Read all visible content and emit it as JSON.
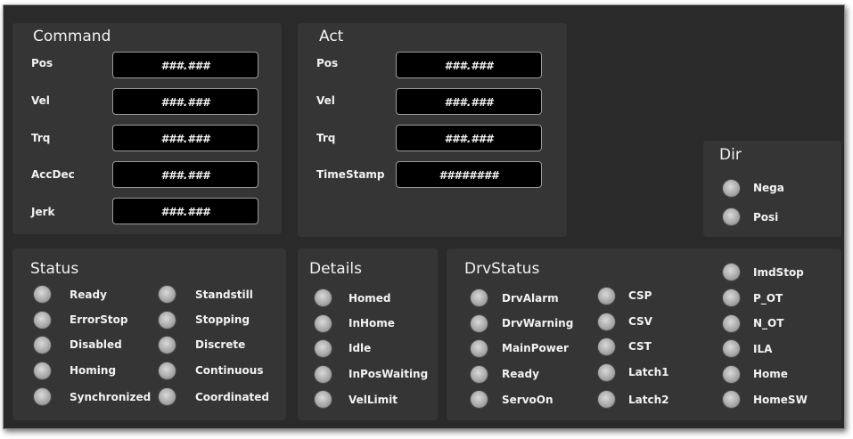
{
  "command": {
    "title": "Command",
    "fields": [
      {
        "label": "Pos",
        "value": "###.###"
      },
      {
        "label": "Vel",
        "value": "###.###"
      },
      {
        "label": "Trq",
        "value": "###.###"
      },
      {
        "label": "AccDec",
        "value": "###.###"
      },
      {
        "label": "Jerk",
        "value": "###.###"
      }
    ]
  },
  "act": {
    "title": "Act",
    "fields": [
      {
        "label": "Pos",
        "value": "###.###"
      },
      {
        "label": "Vel",
        "value": "###.###"
      },
      {
        "label": "Trq",
        "value": "###.###"
      },
      {
        "label": "TimeStamp",
        "value": "########"
      }
    ]
  },
  "dir": {
    "title": "Dir",
    "items": [
      "Nega",
      "Posi"
    ]
  },
  "status": {
    "title": "Status",
    "col1": [
      "Ready",
      "ErrorStop",
      "Disabled",
      "Homing",
      "Synchronized"
    ],
    "col2": [
      "Standstill",
      "Stopping",
      "Discrete",
      "Continuous",
      "Coordinated"
    ]
  },
  "details": {
    "title": "Details",
    "items": [
      "Homed",
      "InHome",
      "Idle",
      "InPosWaiting",
      "VelLimit"
    ]
  },
  "drvstatus": {
    "title": "DrvStatus",
    "col1": [
      "DrvAlarm",
      "DrvWarning",
      "MainPower",
      "Ready",
      "ServoOn"
    ],
    "col2": [
      "CSP",
      "CSV",
      "CST",
      "Latch1",
      "Latch2"
    ]
  },
  "signals": {
    "items": [
      "ImdStop",
      "P_OT",
      "N_OT",
      "ILA",
      "Home",
      "HomeSW"
    ]
  },
  "colors": {
    "background": "#2a2a2a",
    "panel": "#353535",
    "value_box": "#000000",
    "led_off": "#a9a9a9",
    "text": "#f2f2f2"
  }
}
